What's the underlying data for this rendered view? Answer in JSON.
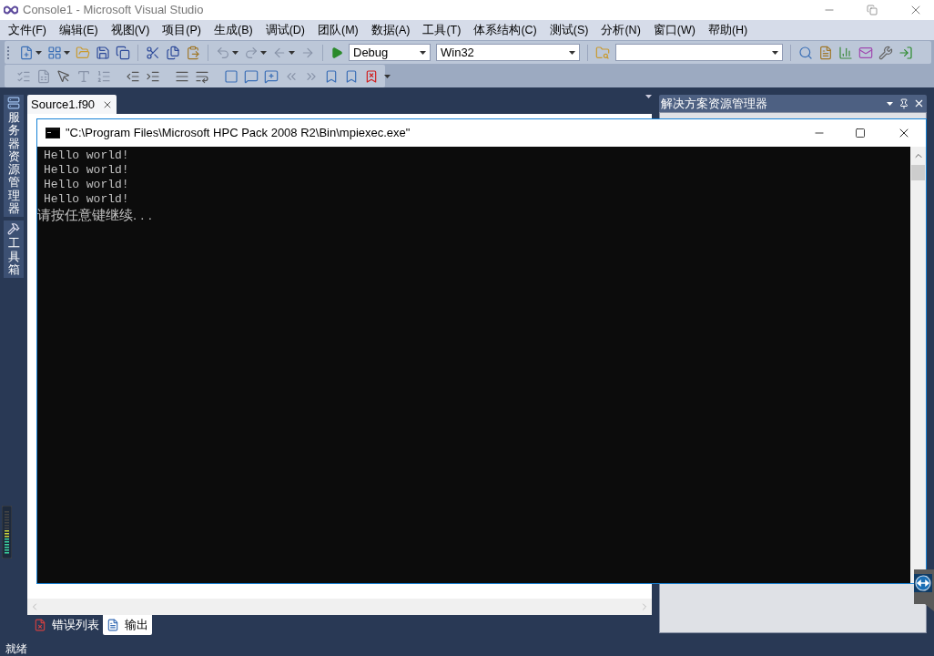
{
  "window": {
    "title": "Console1 - Microsoft Visual Studio"
  },
  "menu": [
    "文件(F)",
    "编辑(E)",
    "视图(V)",
    "项目(P)",
    "生成(B)",
    "调试(D)",
    "团队(M)",
    "数据(A)",
    "工具(T)",
    "体系结构(C)",
    "测试(S)",
    "分析(N)",
    "窗口(W)",
    "帮助(H)"
  ],
  "toolbar": {
    "configuration": "Debug",
    "platform": "Win32"
  },
  "left_strip": [
    "服务器资源管理器",
    "工具箱"
  ],
  "editor": {
    "tabs": [
      {
        "label": "Source1.f90",
        "selected": true
      }
    ]
  },
  "solution_explorer": {
    "title": "解决方案资源管理器"
  },
  "bottom_tabs": [
    {
      "label": "错误列表",
      "selected": false
    },
    {
      "label": "输出",
      "selected": true
    }
  ],
  "status_bar": "就绪",
  "console": {
    "title": "\"C:\\Program Files\\Microsoft HPC Pack 2008 R2\\Bin\\mpiexec.exe\"",
    "lines": [
      "Hello world!",
      "Hello world!",
      "Hello world!",
      "Hello world!",
      "请按任意键继续. . ."
    ]
  }
}
